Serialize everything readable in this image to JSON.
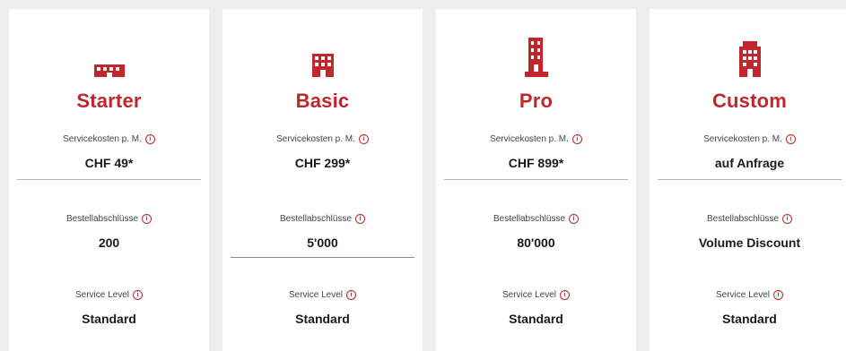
{
  "colors": {
    "accent": "#c0272d",
    "background": "#ededed",
    "card": "#ffffff"
  },
  "plans": [
    {
      "icon": "small-building-icon",
      "name": "Starter",
      "service_cost_label": "Servicekosten p. M.",
      "service_cost_value": "CHF 49*",
      "orders_label": "Bestellabschlüsse",
      "orders_value": "200",
      "service_level_label": "Service Level",
      "service_level_value": "Standard"
    },
    {
      "icon": "office-building-icon",
      "name": "Basic",
      "service_cost_label": "Servicekosten p. M.",
      "service_cost_value": "CHF 299*",
      "orders_label": "Bestellabschlüsse",
      "orders_value": "5'000",
      "service_level_label": "Service Level",
      "service_level_value": "Standard"
    },
    {
      "icon": "tall-building-icon",
      "name": "Pro",
      "service_cost_label": "Servicekosten p. M.",
      "service_cost_value": "CHF 899*",
      "orders_label": "Bestellabschlüsse",
      "orders_value": "80'000",
      "service_level_label": "Service Level",
      "service_level_value": "Standard"
    },
    {
      "icon": "skyscraper-icon",
      "name": "Custom",
      "service_cost_label": "Servicekosten p. M.",
      "service_cost_value": "auf Anfrage",
      "orders_label": "Bestellabschlüsse",
      "orders_value": "Volume Discount",
      "service_level_label": "Service Level",
      "service_level_value": "Standard"
    }
  ]
}
